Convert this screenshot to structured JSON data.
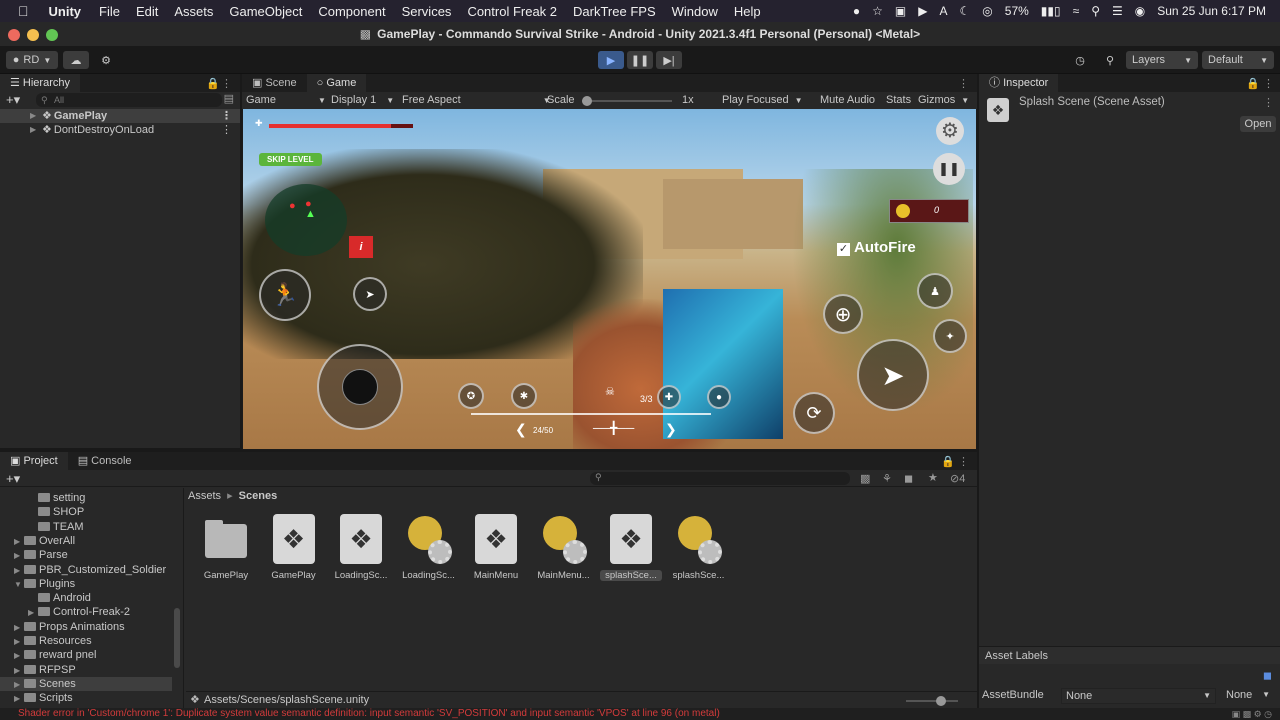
{
  "menubar": {
    "app": "Unity",
    "items": [
      "File",
      "Edit",
      "Assets",
      "GameObject",
      "Component",
      "Services",
      "Control Freak 2",
      "DarkTree FPS",
      "Window",
      "Help"
    ],
    "battery": "57%",
    "datetime": "Sun 25 Jun  6:17 PM"
  },
  "window": {
    "title": "GamePlay - Commando Survival Strike - Android - Unity 2021.3.4f1 Personal (Personal) <Metal>"
  },
  "toolbar": {
    "account": "RD",
    "layers": "Layers",
    "layout": "Default"
  },
  "hierarchy": {
    "tab": "Hierarchy",
    "search_placeholder": "All",
    "items": [
      {
        "label": "GamePlay"
      },
      {
        "label": "DontDestroyOnLoad"
      }
    ]
  },
  "game_view": {
    "tabs": [
      "Scene",
      "Game"
    ],
    "mode": "Game",
    "display": "Display 1",
    "aspect": "Free Aspect",
    "scale_label": "Scale",
    "scale_value": "1x",
    "play_focused": "Play Focused",
    "mute": "Mute Audio",
    "stats": "Stats",
    "gizmos": "Gizmos",
    "hud": {
      "skip_level": "SKIP LEVEL",
      "coins": "0",
      "autofire": "AutoFire",
      "grenades": "3/3",
      "ammo": "24/50",
      "health_fraction": 0.85
    }
  },
  "inspector": {
    "tab": "Inspector",
    "title": "Splash Scene (Scene Asset)",
    "open_button": "Open",
    "asset_labels": "Asset Labels",
    "assetbundle_label": "AssetBundle",
    "assetbundle_value": "None",
    "variant_value": "None"
  },
  "project": {
    "tabs": [
      "Project",
      "Console"
    ],
    "breadcrumb_root": "Assets",
    "breadcrumb_current": "Scenes",
    "hidden_count": "4",
    "folders": [
      {
        "label": "setting",
        "indent": 2,
        "expanded": false
      },
      {
        "label": "SHOP",
        "indent": 2,
        "expanded": false
      },
      {
        "label": "TEAM",
        "indent": 2,
        "expanded": false
      },
      {
        "label": "OverAll",
        "indent": 1,
        "expanded": false
      },
      {
        "label": "Parse",
        "indent": 1,
        "expanded": false
      },
      {
        "label": "PBR_Customized_Soldier",
        "indent": 1,
        "expanded": false
      },
      {
        "label": "Plugins",
        "indent": 1,
        "expanded": true
      },
      {
        "label": "Android",
        "indent": 2,
        "expanded": false
      },
      {
        "label": "Control-Freak-2",
        "indent": 2,
        "expanded": false
      },
      {
        "label": "Props Animations",
        "indent": 1,
        "expanded": false
      },
      {
        "label": "Resources",
        "indent": 1,
        "expanded": false
      },
      {
        "label": "reward pnel",
        "indent": 1,
        "expanded": false
      },
      {
        "label": "RFPSP",
        "indent": 1,
        "expanded": false
      },
      {
        "label": "Scenes",
        "indent": 1,
        "expanded": false
      },
      {
        "label": "Scripts",
        "indent": 1,
        "expanded": false
      }
    ],
    "assets": [
      {
        "label": "GamePlay",
        "icon": "folder-icon"
      },
      {
        "label": "GamePlay",
        "icon": "unity-scene-icon"
      },
      {
        "label": "LoadingSc...",
        "icon": "unity-scene-icon"
      },
      {
        "label": "LoadingSc...",
        "icon": "lighting-settings-icon"
      },
      {
        "label": "MainMenu",
        "icon": "unity-scene-icon"
      },
      {
        "label": "MainMenu...",
        "icon": "lighting-settings-icon"
      },
      {
        "label": "splashSce...",
        "icon": "unity-scene-icon"
      },
      {
        "label": "splashSce...",
        "icon": "lighting-settings-icon"
      }
    ],
    "path": "Assets/Scenes/splashScene.unity"
  },
  "status": {
    "error": "Shader error in 'Custom/chrome 1': Duplicate system value semantic definition: input semantic 'SV_POSITION' and input semantic 'VPOS' at line 96 (on metal)"
  }
}
